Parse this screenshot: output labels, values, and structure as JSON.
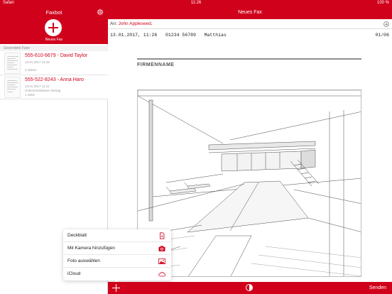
{
  "status_bar": {
    "carrier": "Safari",
    "time": "11:26",
    "battery": "100 %"
  },
  "sidebar": {
    "title": "Faxbot",
    "new_fax_label": "Neues Fax",
    "section_label": "Gesendete Faxe",
    "items": [
      {
        "title": "555-610-6679 - David Taylor",
        "date": "13.01.2017 11:18",
        "line2": "",
        "pages": "3 Seiten"
      },
      {
        "title": "555-522-8243 - Anna Haro",
        "date": "13.01.2017 11:11",
        "line2": "Unterschriebener Vertrag",
        "pages": "1 Seite"
      }
    ]
  },
  "main": {
    "title": "Neues Fax",
    "to_label": "An:",
    "to_value": "John Appleseed,",
    "fax_header": "13.01.2017, 11:26   01234 56789   Matthias",
    "page_number": "01/06",
    "company": "FIRMENNAME"
  },
  "popover": {
    "items": [
      {
        "label": "Deckblatt",
        "icon": "document-icon"
      },
      {
        "label": "Mit Kamera hinzufügen",
        "icon": "camera-icon"
      },
      {
        "label": "Foto auswählen",
        "icon": "photo-icon"
      },
      {
        "label": "iCloud",
        "icon": "cloud-icon"
      }
    ]
  },
  "toolbar": {
    "send_label": "Senden"
  },
  "colors": {
    "accent": "#d0021b"
  }
}
